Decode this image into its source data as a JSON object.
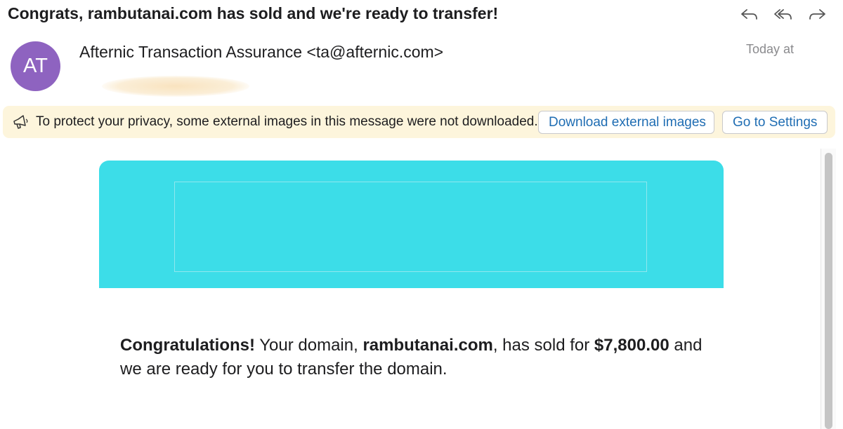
{
  "message": {
    "subject": "Congrats, rambutanai.com has sold and we're ready to transfer!",
    "avatar_initials": "AT",
    "avatar_color": "#8e63c0",
    "sender": "Afternic Transaction Assurance <ta@afternic.com>",
    "date": "Today at"
  },
  "toolbar": {
    "reply_icon": "reply-icon",
    "reply_all_icon": "reply-all-icon",
    "forward_icon": "forward-icon"
  },
  "privacy_notice": {
    "icon": "speaker-icon",
    "text": "To protect your privacy, some external images in this message were not downloaded.",
    "download_label": "Download external images",
    "settings_label": "Go to Settings",
    "background": "#fdf5dc"
  },
  "email_body": {
    "banner_color": "#3cdde8",
    "intro_bold": "Congratulations!",
    "text_1": " Your domain, ",
    "domain": "rambutanai.com",
    "text_2": ", has sold for ",
    "price": "$7,800.00",
    "text_3": " and we are ready for you to transfer the domain."
  }
}
